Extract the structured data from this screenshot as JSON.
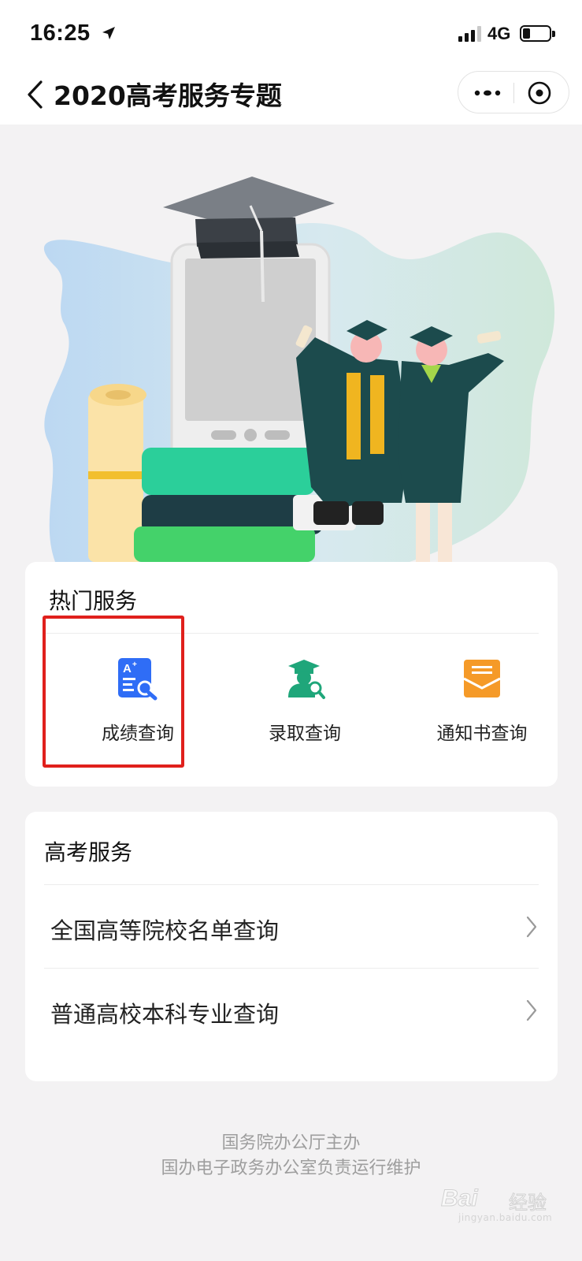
{
  "status_bar": {
    "time": "16:25",
    "network": "4G",
    "icons": [
      "location-arrow-icon",
      "cellular-signal-icon",
      "battery-icon"
    ]
  },
  "nav": {
    "title": "2020高考服务专题",
    "icons": [
      "back-icon",
      "more-icon",
      "close-miniprogram-icon"
    ]
  },
  "hot_services": {
    "title": "热门服务",
    "items": [
      {
        "label": "成绩查询",
        "icon": "score-search-icon",
        "color": "#2f6df6"
      },
      {
        "label": "录取查询",
        "icon": "admission-search-icon",
        "color": "#1fa67a"
      },
      {
        "label": "通知书查询",
        "icon": "notice-letter-icon",
        "color": "#f59a28"
      }
    ],
    "highlight_color": "#e0201c"
  },
  "gaokao_services": {
    "title": "高考服务",
    "items": [
      {
        "label": "全国高等院校名单查询",
        "icon": "chevron-right-icon"
      },
      {
        "label": "普通高校本科专业查询",
        "icon": "chevron-right-icon"
      }
    ]
  },
  "footer": {
    "line1": "国务院办公厅主办",
    "line2": "国办电子政务办公室负责运行维护"
  },
  "watermark": {
    "brand": "Bai",
    "brand_cn": "经验",
    "url": "jingyan.baidu.com"
  },
  "colors": {
    "background": "#f3f2f3",
    "card": "#ffffff",
    "text": "#111111",
    "footer_text": "#9e9e9e"
  }
}
